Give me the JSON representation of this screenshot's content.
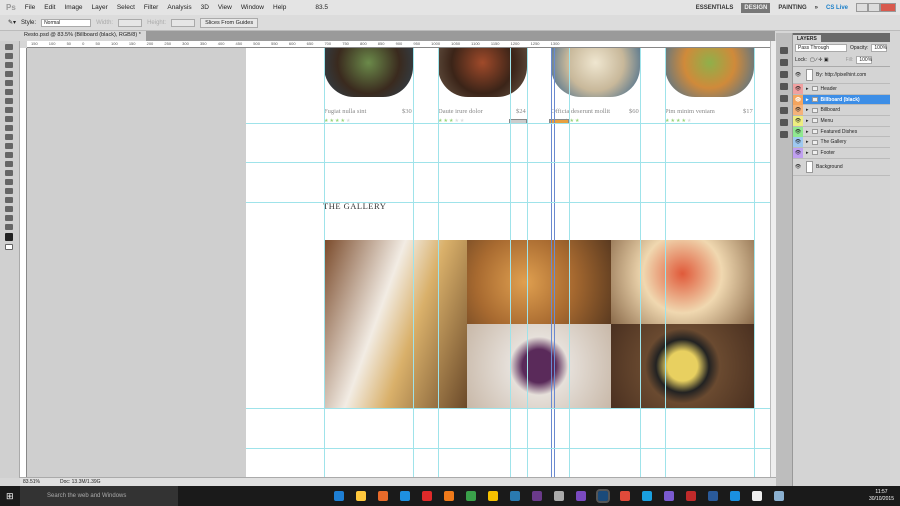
{
  "menu": [
    "File",
    "Edit",
    "Image",
    "Layer",
    "Select",
    "Filter",
    "Analysis",
    "3D",
    "View",
    "Window",
    "Help"
  ],
  "app_logo": "Ps",
  "zoom_box": "83.5",
  "workspaces": {
    "essentials": "ESSENTIALS",
    "design": "DESIGN",
    "painting": "PAINTING",
    "more": "»",
    "cslive": "CS Live"
  },
  "options": {
    "style_label": "Style:",
    "style_value": "Normal",
    "width_label": "Width:",
    "height_label": "Height:",
    "slices_button": "Slices From Guides"
  },
  "document_tab": "Resto.psd @ 83.5% (Billboard (black), RGB/8) *",
  "ruler": "150 100 50 0 50 100 150 200 250 300 350 400 450 500 550 600 650 700 750 800 850 900 950 1000 1050 1100 1150 1200 1250 1300",
  "cards": [
    {
      "title": "Fugiat nulla sint",
      "price": "$30",
      "rating": 4
    },
    {
      "title": "Daute irure dolor",
      "price": "$24",
      "rating": 3
    },
    {
      "title": "Officia deserunt mollit",
      "price": "$60",
      "rating": 3
    },
    {
      "title": "Pim minim veniam",
      "price": "$17",
      "rating": 4
    }
  ],
  "gallery_title": "THE GALLERY",
  "status": {
    "zoom": "83.51%",
    "doc": "Doc: 13.3M/1.39G"
  },
  "layers": {
    "tab": "LAYERS",
    "blend": "Pass Through",
    "opacity_label": "Opacity:",
    "opacity": "100%",
    "lock_label": "Lock:",
    "fill_label": "Fill:",
    "fill": "100%",
    "items": [
      {
        "name": "By: http://pixelhint.com",
        "color": "#d4d4d4"
      },
      {
        "name": "Header",
        "color": "#f0a0a0"
      },
      {
        "name": "Billboard (black)",
        "color": "#f5a55e"
      },
      {
        "name": "Billboard",
        "color": "#f5b27a"
      },
      {
        "name": "Menu",
        "color": "#eded80"
      },
      {
        "name": "Featured Dishes",
        "color": "#90e890"
      },
      {
        "name": "The Gallery",
        "color": "#9ec8f0"
      },
      {
        "name": "Footer",
        "color": "#c0a0f0"
      },
      {
        "name": "Background",
        "color": "#d4d4d4"
      }
    ]
  },
  "taskbar": {
    "search": "Search the web and Windows",
    "time": "11:57",
    "date": "30/10/2015"
  }
}
